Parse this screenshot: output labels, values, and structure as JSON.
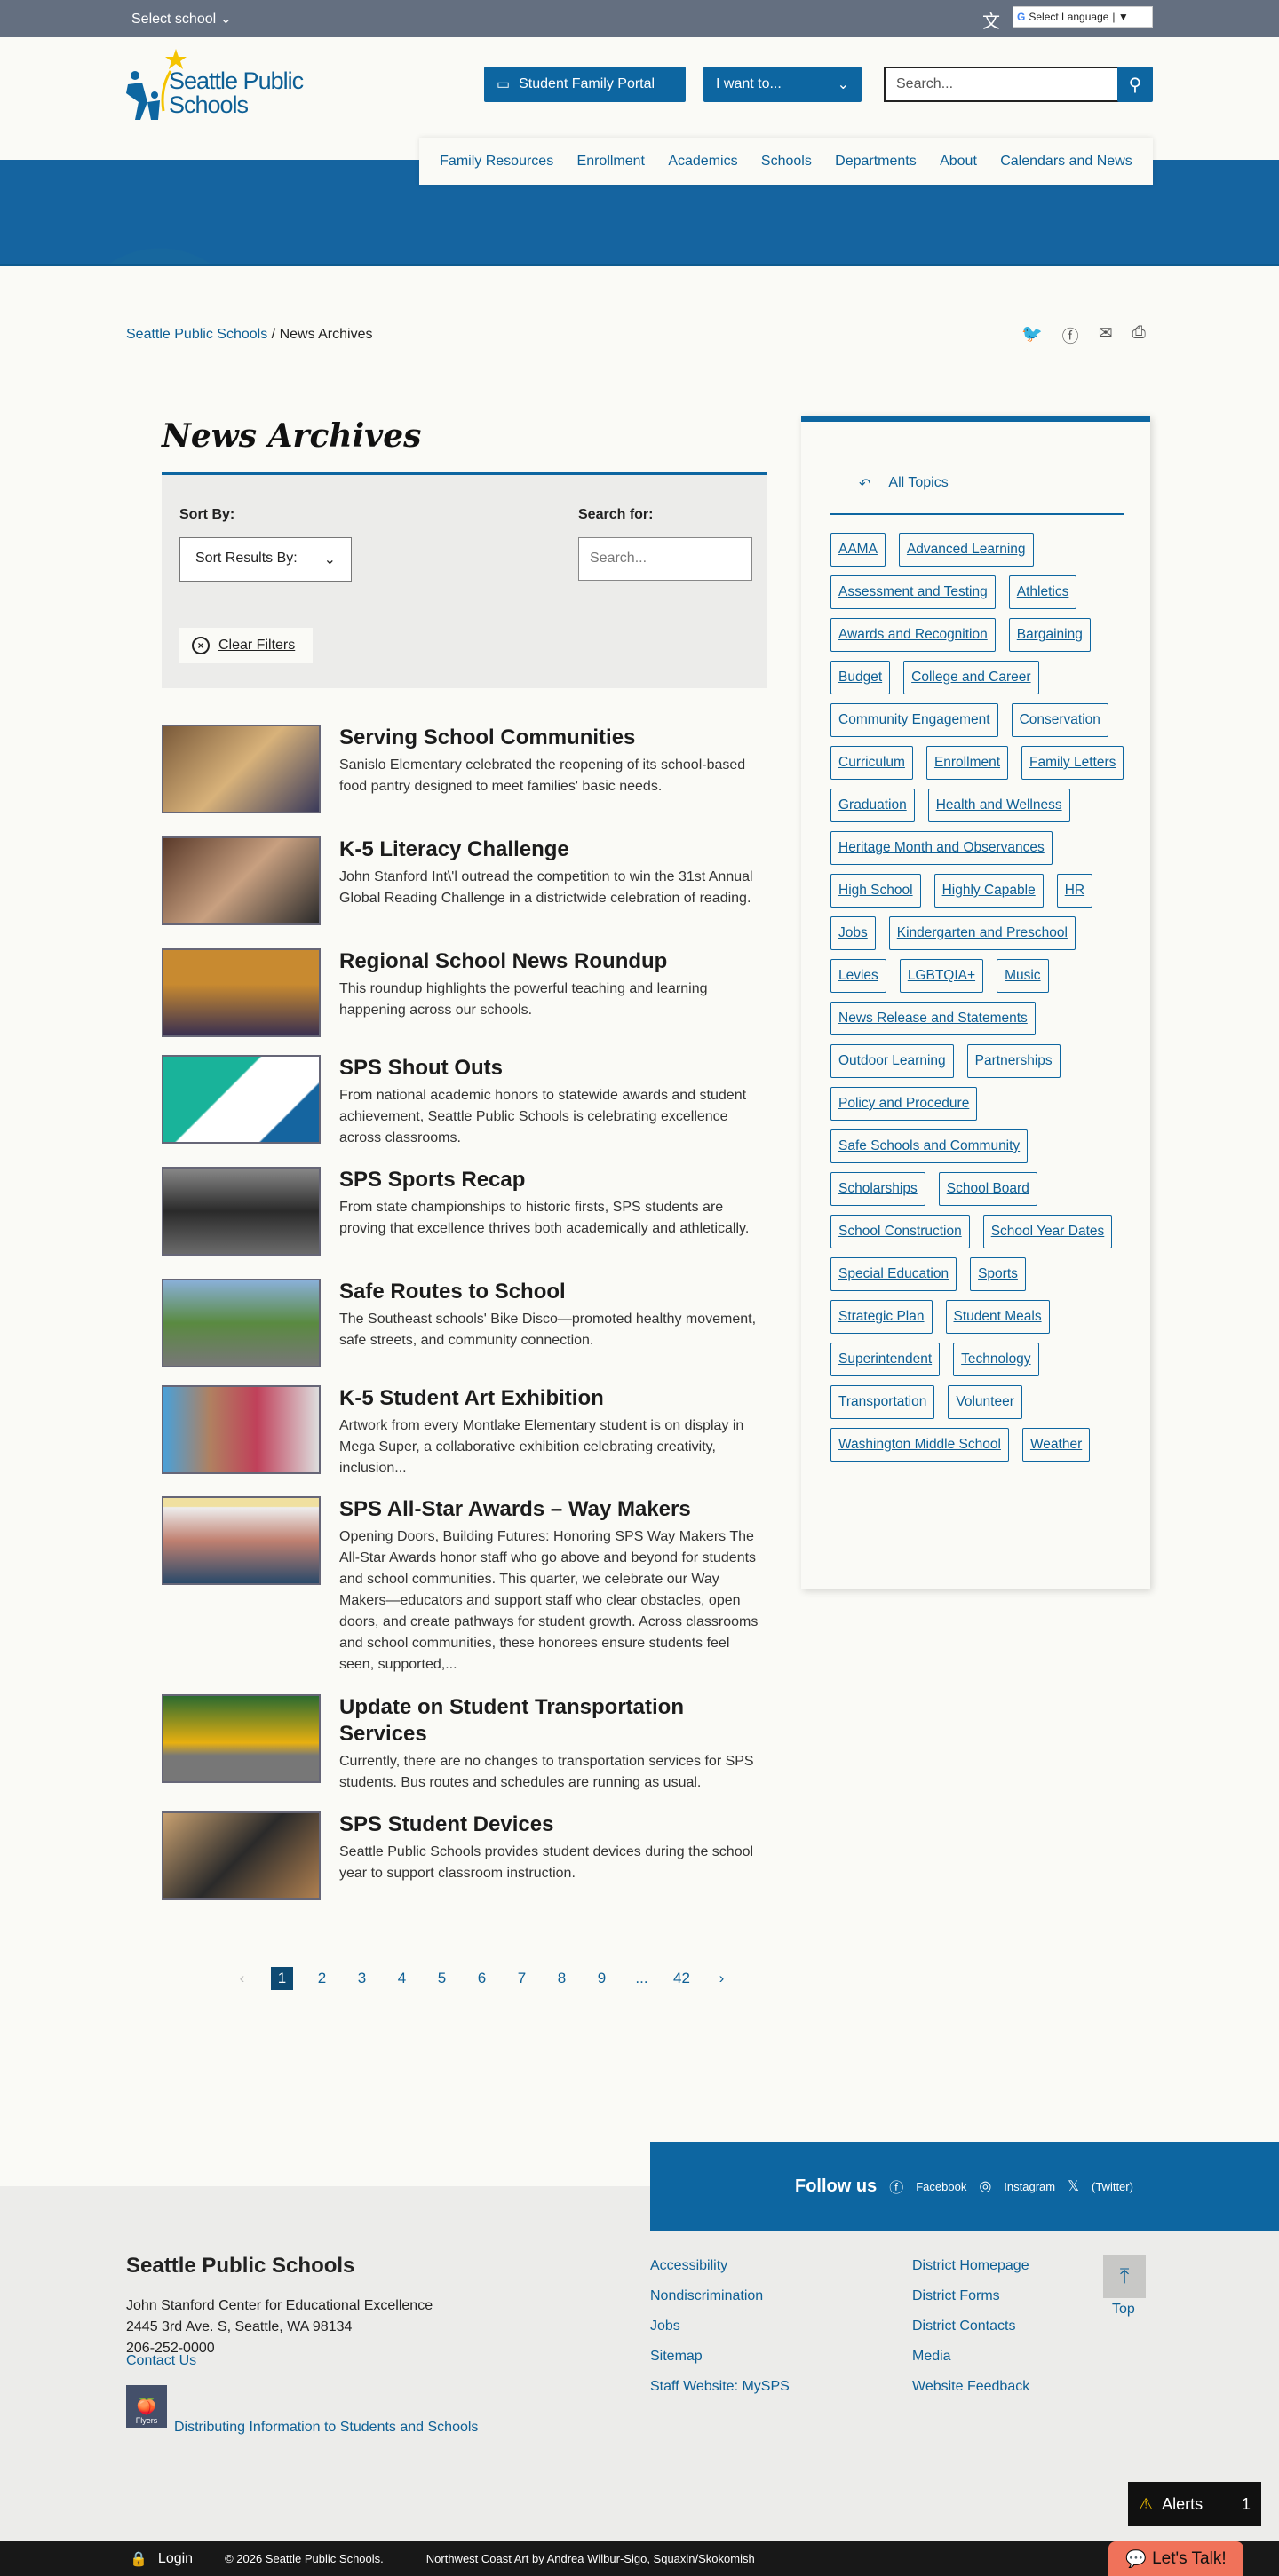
{
  "topbar": {
    "select_school": "Select school",
    "language": "Select Language"
  },
  "header": {
    "logo_line1": "Seattle Public",
    "logo_line2": "Schools",
    "portal": "Student Family Portal",
    "i_want": "I want to...",
    "search_placeholder": "Search..."
  },
  "nav": [
    "Family Resources",
    "Enrollment",
    "Academics",
    "Schools",
    "Departments",
    "About",
    "Calendars and News"
  ],
  "breadcrumb": {
    "home": "Seattle Public Schools",
    "sep": "/",
    "current": "News Archives"
  },
  "page_title": "News Archives",
  "filters": {
    "sort_label": "Sort By:",
    "sort_value": "Sort Results By:",
    "search_label": "Search for:",
    "search_placeholder": "Search...",
    "clear": "Clear Filters"
  },
  "news": [
    {
      "title": "Serving School Communities",
      "summary": "Sanislo Elementary celebrated the reopening of its school-based food pantry designed to meet families' basic needs."
    },
    {
      "title": "K-5 Literacy Challenge",
      "summary": "John Stanford Int\\'l outread the competition to win the 31st Annual Global Reading Challenge in a districtwide celebration of reading."
    },
    {
      "title": "Regional School News Roundup",
      "summary": "This roundup highlights the powerful teaching and learning happening across our schools."
    },
    {
      "title": "SPS Shout Outs",
      "summary": "From national academic honors to statewide awards and student achievement, Seattle Public Schools is celebrating excellence across classrooms."
    },
    {
      "title": "SPS Sports Recap",
      "summary": "From state championships to historic firsts, SPS students are proving that excellence thrives both academically and athletically."
    },
    {
      "title": "Safe Routes to School",
      "summary": "The Southeast schools' Bike Disco—promoted healthy movement, safe streets, and community connection."
    },
    {
      "title": " K-5 Student Art Exhibition",
      "summary": "Artwork from every Montlake Elementary student is on display in Mega Super, a collaborative exhibition celebrating creativity, inclusion..."
    },
    {
      "title": "SPS All-Star Awards – Way Makers",
      "summary": "Opening Doors, Building Futures: Honoring SPS Way Makers The All-Star Awards honor staff who go above and beyond for students and school communities. This quarter, we celebrate our Way Makers—educators and support staff who clear obstacles, open doors, and create pathways for student growth. Across classrooms and school communities, these honorees ensure students feel seen, supported,..."
    },
    {
      "title": "Update on Student Transportation Services",
      "summary": "Currently, there are no changes to transportation services for SPS students. Bus routes and schedules are running as usual."
    },
    {
      "title": "SPS Student Devices",
      "summary": "Seattle Public Schools provides student devices during the school year to support classroom instruction."
    }
  ],
  "pagination": {
    "prev": "‹",
    "pages": [
      "1",
      "2",
      "3",
      "4",
      "5",
      "6",
      "7",
      "8",
      "9",
      "...",
      "42"
    ],
    "current": "1",
    "next": "›"
  },
  "sidebar": {
    "all_topics": "All Topics",
    "tags": [
      "AAMA",
      "Advanced Learning",
      "Assessment and Testing",
      "Athletics",
      "Awards and Recognition",
      "Bargaining",
      "Budget",
      "College and Career",
      "Community Engagement",
      "Conservation",
      "Curriculum",
      "Enrollment",
      "Family Letters",
      "Graduation",
      "Health and Wellness",
      "Heritage Month and Observances",
      "High School",
      "Highly Capable",
      "HR",
      "Jobs",
      "Kindergarten and Preschool",
      "Levies",
      "LGBTQIA+",
      "Music",
      "News Release and Statements",
      "Outdoor Learning",
      "Partnerships",
      "Policy and Procedure",
      "Safe Schools and Community",
      "Scholarships",
      "School Board",
      "School Construction",
      "School Year Dates",
      "Special Education",
      "Sports",
      "Strategic Plan",
      "Student Meals",
      "Superintendent",
      "Technology",
      "Transportation",
      "Volunteer",
      "Washington Middle School",
      "Weather"
    ]
  },
  "follow": {
    "label": "Follow us",
    "facebook": "Facebook",
    "instagram": "Instagram",
    "twitter": "(Twitter)"
  },
  "footer": {
    "name": "Seattle Public Schools",
    "address1": "John Stanford Center for Educational Excellence",
    "address2": "2445 3rd Ave. S, Seattle, WA 98134",
    "phone": "206-252-0000",
    "contact": "Contact Us",
    "flyers_label": "Flyers",
    "flyers_link": "Distributing Information to Students and Schools",
    "col1": [
      "Accessibility",
      "Nondiscrimination",
      "Jobs",
      "Sitemap",
      "Staff Website: MySPS"
    ],
    "col2": [
      "District Homepage",
      "District Forms",
      "District Contacts",
      "Media",
      "Website Feedback"
    ],
    "top": "Top"
  },
  "bottom": {
    "login": "Login",
    "copyright": "© 2026 Seattle Public Schools.",
    "art_credit": "Northwest Coast Art by Andrea Wilbur-Sigo, Squaxin/Skokomish"
  },
  "alerts": {
    "label": "Alerts",
    "count": "1"
  },
  "chat": {
    "label": "Let's Talk!"
  },
  "colors": {
    "brand": "#0d66a1",
    "topbar": "#646f80",
    "footer": "#ececea",
    "chat": "#f0725a"
  }
}
